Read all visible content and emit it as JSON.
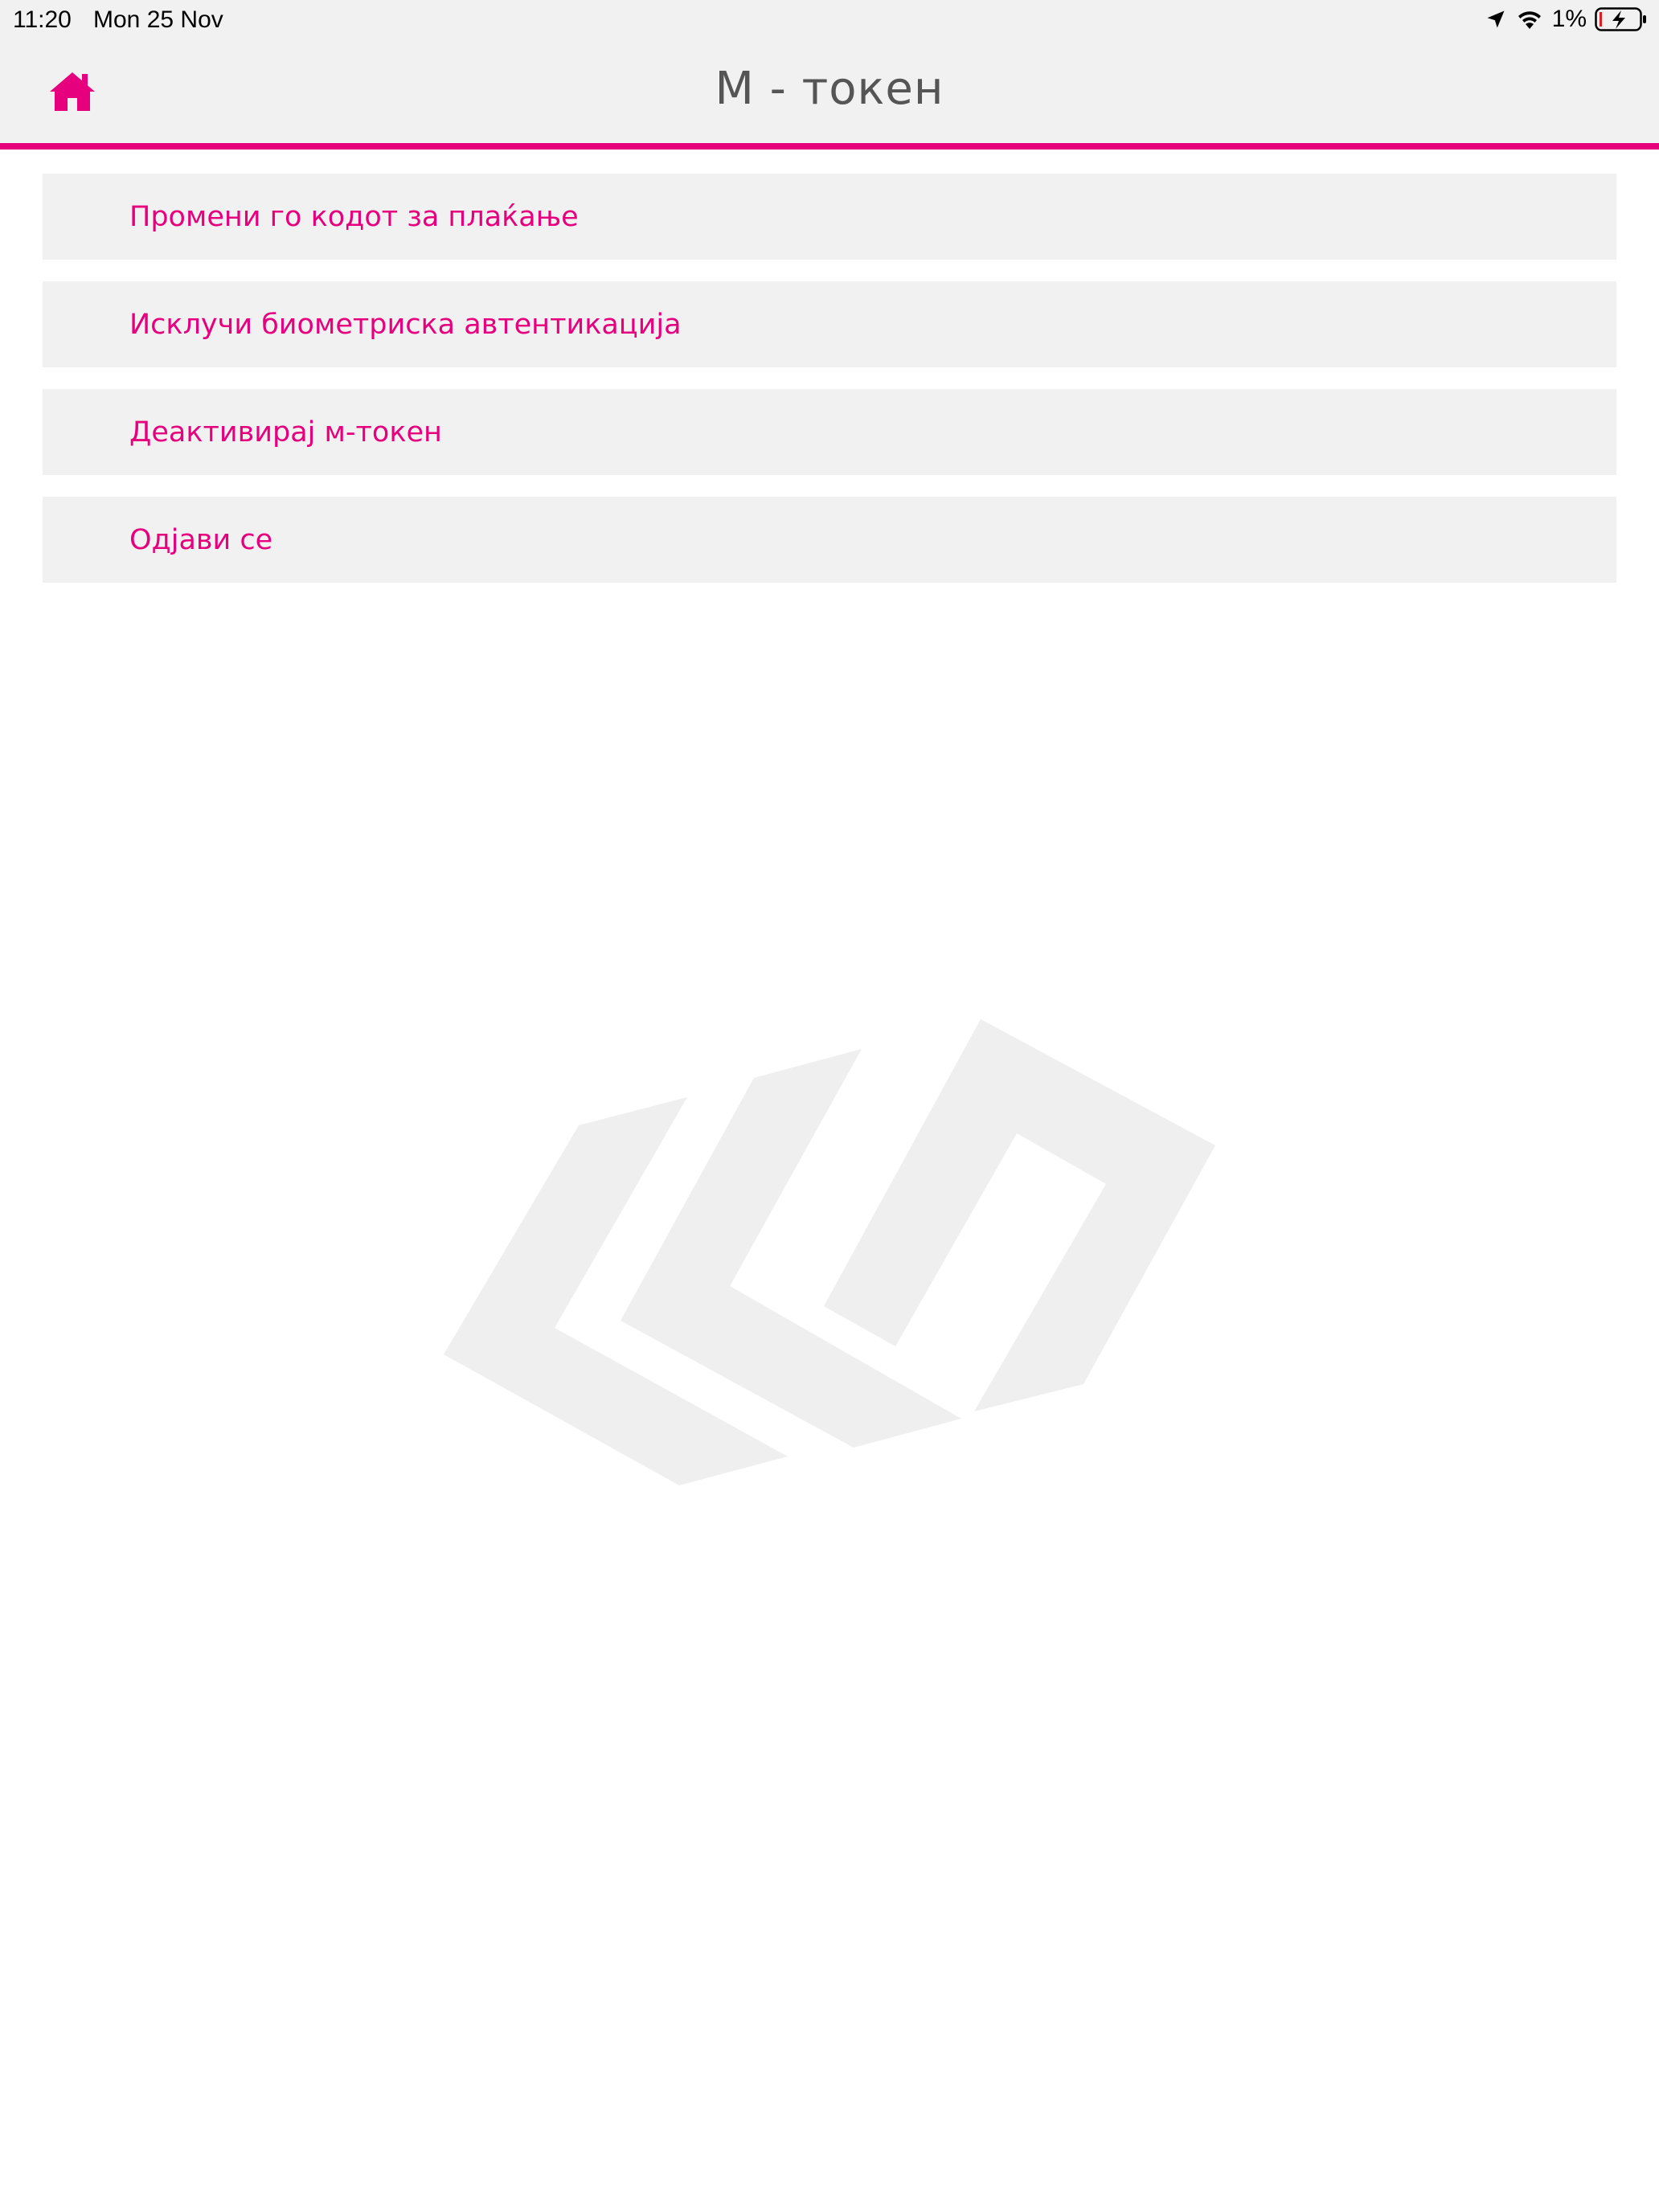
{
  "status_bar": {
    "time": "11:20",
    "date": "Mon 25 Nov",
    "battery_percent": "1%",
    "icons": [
      "location-arrow-icon",
      "wifi-icon",
      "battery-charging-icon"
    ]
  },
  "header": {
    "title": "M - токен",
    "home_icon": "home-icon",
    "accent_color": "#e6007e"
  },
  "menu": {
    "items": [
      {
        "label": "Промени го кодот за плаќање"
      },
      {
        "label": "Исклучи биометриска автентикација"
      },
      {
        "label": "Деактивирај м-токен"
      },
      {
        "label": "Одјави се"
      }
    ]
  },
  "colors": {
    "accent": "#e6007e",
    "panel_bg": "#f1f1f1",
    "title_text": "#555555",
    "watermark": "#efefef"
  }
}
